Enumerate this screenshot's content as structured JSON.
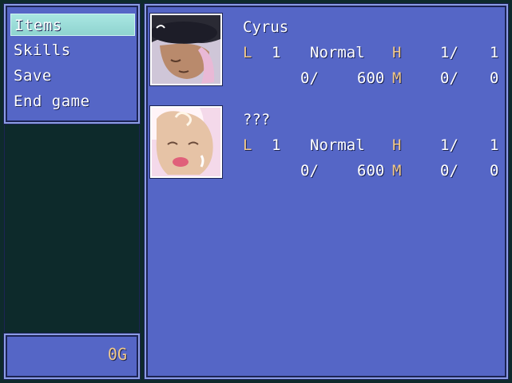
{
  "menu": {
    "items": [
      {
        "label": "Items",
        "selected": true
      },
      {
        "label": "Skills",
        "selected": false
      },
      {
        "label": "Save",
        "selected": false
      },
      {
        "label": "End game",
        "selected": false
      }
    ]
  },
  "gold": {
    "value": "0G"
  },
  "party": [
    {
      "name": "Cyrus",
      "level_label": "L",
      "level": "1",
      "state": "Normal",
      "hp_label": "H",
      "hp": "1/",
      "hp_max": "1",
      "exp": "0/",
      "exp_next": "600",
      "mp_label": "M",
      "mp": "0/",
      "mp_max": "0",
      "portrait_icon": "cyrus-portrait"
    },
    {
      "name": "???",
      "level_label": "L",
      "level": "1",
      "state": "Normal",
      "hp_label": "H",
      "hp": "1/",
      "hp_max": "1",
      "exp": "0/",
      "exp_next": "600",
      "mp_label": "M",
      "mp": "0/",
      "mp_max": "0",
      "portrait_icon": "unknown-girl-portrait"
    }
  ],
  "colors": {
    "window": "#5566c6",
    "label": "#f2c98a",
    "cursor": "#a9e6e2",
    "background": "#0d2a2b"
  }
}
